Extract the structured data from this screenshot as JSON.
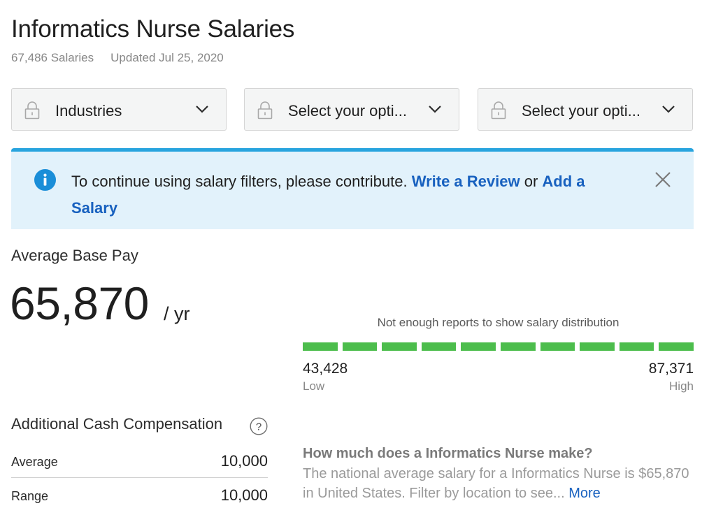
{
  "header": {
    "title": "Informatics Nurse Salaries",
    "salaries_count": "67,486 Salaries",
    "updated": "Updated Jul 25, 2020"
  },
  "filters": [
    {
      "label": "Industries",
      "icon": "lock-icon"
    },
    {
      "label": "Select your opti...",
      "icon": "lock-icon"
    },
    {
      "label": "Select your opti...",
      "icon": "lock-icon"
    }
  ],
  "banner": {
    "text_before": "To continue using salary filters, please contribute. ",
    "link_review": "Write a Review",
    "text_or": " or ",
    "link_salary": "Add a Salary",
    "accent_color": "#28a4de",
    "background_color": "#e2f2fb"
  },
  "average_base_pay": {
    "label": "Average Base Pay",
    "value": "65,870",
    "unit": "/ yr"
  },
  "distribution": {
    "message": "Not enough reports to show salary distribution",
    "low_value": "43,428",
    "low_label": "Low",
    "high_value": "87,371",
    "high_label": "High",
    "bar_color": "#4cbd4c",
    "segments": 10
  },
  "additional_cash": {
    "label": "Additional Cash Compensation",
    "rows": [
      {
        "key": "Average",
        "value": "10,000"
      },
      {
        "key": "Range",
        "value": "10,000"
      }
    ]
  },
  "faq": {
    "question": "How much does a Informatics Nurse make?",
    "answer": "The national average salary for a Informatics Nurse is $65,870 in United States. Filter by location to see...",
    "more": "More"
  }
}
